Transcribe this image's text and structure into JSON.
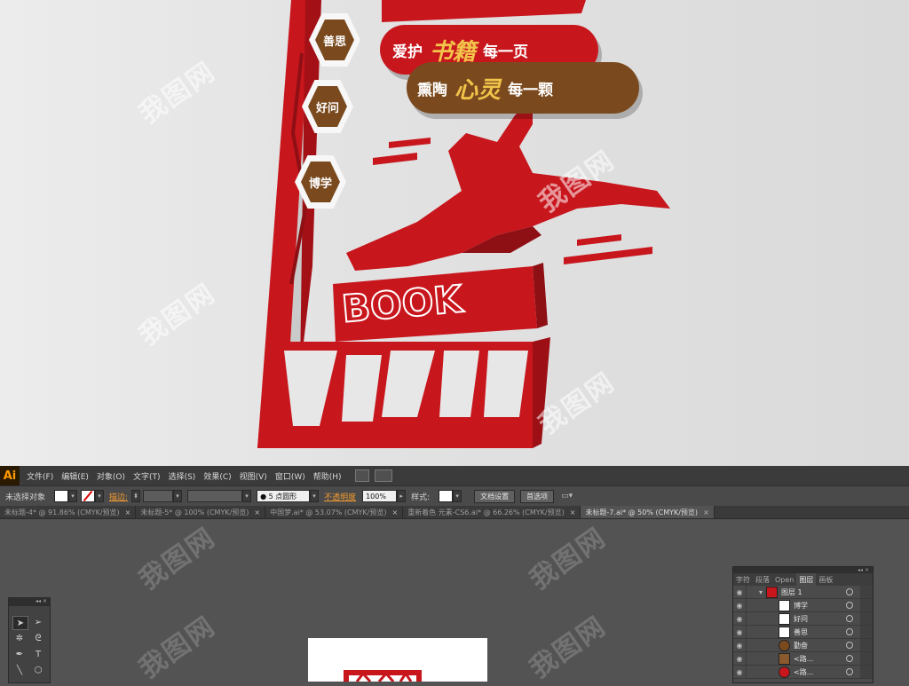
{
  "preview": {
    "hex_labels": [
      "善思",
      "好问",
      "博学"
    ],
    "pill1": {
      "pre": "爱护",
      "big": "书籍",
      "post": "每一页"
    },
    "pill2": {
      "pre": "熏陶",
      "big": "心灵",
      "post": "每一颗"
    },
    "book_text": "BOOK",
    "watermark": "我图网",
    "colors": {
      "red": "#c8161d",
      "brown": "#7a4a1e",
      "gold": "#f2c44a"
    }
  },
  "app": {
    "logo": "Ai",
    "menu": [
      "文件(F)",
      "编辑(E)",
      "对象(O)",
      "文字(T)",
      "选择(S)",
      "效果(C)",
      "视图(V)",
      "窗口(W)",
      "帮助(H)"
    ]
  },
  "control": {
    "selection": "未选择对象",
    "stroke_label": "描边:",
    "brush": "● 5 点圆形",
    "opacity_label": "不透明度",
    "opacity_value": "100%",
    "style_label": "样式:",
    "doc_setup": "文档设置",
    "prefs": "首选项"
  },
  "tabs": [
    {
      "label": "未标题-4* @ 91.86% (CMYK/预览)",
      "active": false
    },
    {
      "label": "未标题-5* @ 100% (CMYK/预览)",
      "active": false
    },
    {
      "label": "中国梦.ai* @ 53.07% (CMYK/预览)",
      "active": false
    },
    {
      "label": "重新着色 元素-CS6.ai* @ 66.26% (CMYK/预览)",
      "active": false
    },
    {
      "label": "未标题-7.ai* @ 50% (CMYK/预览)",
      "active": true
    }
  ],
  "layers_panel": {
    "tabs": [
      "字符",
      "段落",
      "Open",
      "图层",
      "画板"
    ],
    "active_tab": "图层",
    "rows": [
      "图层 1",
      "博学",
      "好问",
      "善思",
      "勤奋",
      "<路...",
      "<路..."
    ]
  }
}
